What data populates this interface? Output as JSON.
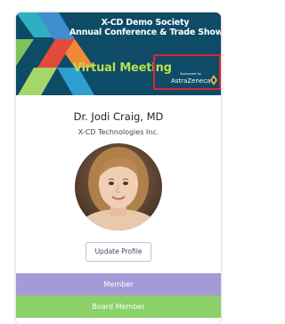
{
  "banner": {
    "title_line1": "X-CD Demo Society",
    "title_line2": "Annual Conference & Trade Show",
    "subtitle": "Virtual Meeting",
    "sponsor_caption": "Sponsored by",
    "sponsor_name": "AstraZeneca",
    "logo_icon": "x-logo-icon",
    "sponsor_icon": "astrazeneca-logo-icon",
    "background_color": "#0e4b66",
    "accent_green": "#b6e04a",
    "highlight_color": "#e0232e"
  },
  "profile": {
    "name": "Dr. Jodi Craig, MD",
    "company": "X-CD Technologies Inc.",
    "avatar_icon": "profile-photo-avatar"
  },
  "actions": {
    "update_profile_label": "Update Profile"
  },
  "roles": [
    {
      "label": "Member",
      "color": "#a69ad6"
    },
    {
      "label": "Board Member",
      "color": "#8cd06a"
    }
  ]
}
